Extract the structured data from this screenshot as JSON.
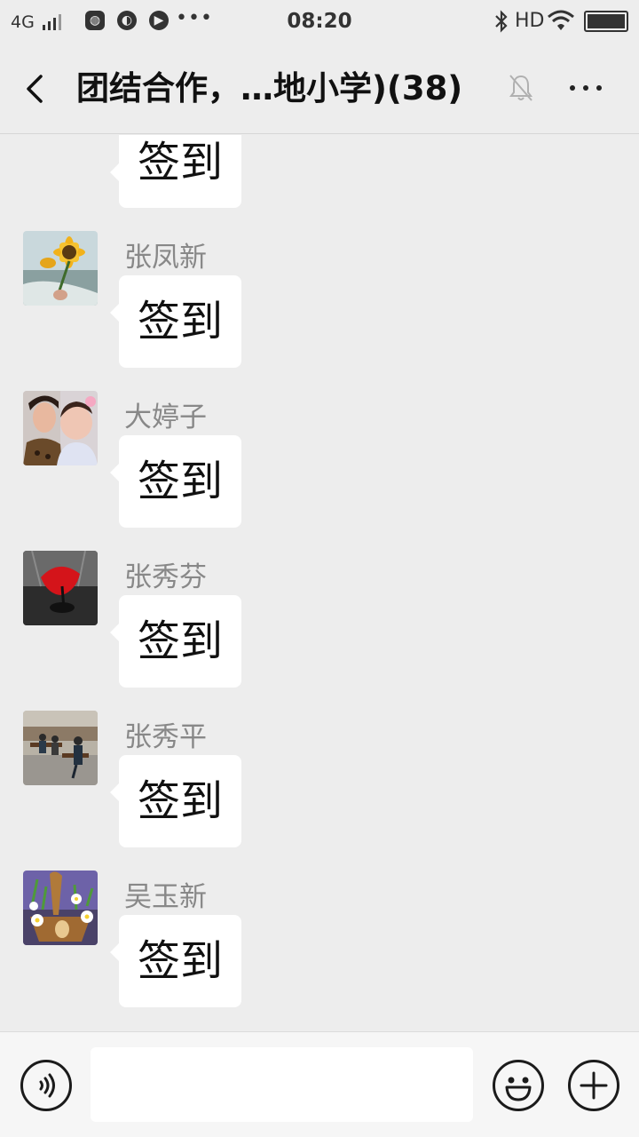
{
  "status_bar": {
    "network": "4G",
    "time": "08:20",
    "hd": "HD",
    "notification_icons": [
      "browser-icon",
      "chat-notification-icon",
      "music-player-icon"
    ],
    "overflow": "•••"
  },
  "header": {
    "title": "团结合作，…地小学)(38)",
    "muted": true
  },
  "messages": [
    {
      "sender": "",
      "text": "签到",
      "avatar_icon": "avatar-partial"
    },
    {
      "sender": "张凤新",
      "text": "签到",
      "avatar_icon": "sunflower-avatar"
    },
    {
      "sender": "大婷子",
      "text": "签到",
      "avatar_icon": "selfie-avatar"
    },
    {
      "sender": "张秀芬",
      "text": "签到",
      "avatar_icon": "red-umbrella-avatar"
    },
    {
      "sender": "张秀平",
      "text": "签到",
      "avatar_icon": "park-photo-avatar"
    },
    {
      "sender": "吴玉新",
      "text": "签到",
      "avatar_icon": "flower-basket-avatar"
    }
  ],
  "input_bar": {
    "voice_icon": "voice-icon",
    "text_value": "",
    "emoji_icon": "emoji-icon",
    "plus_icon": "plus-icon"
  },
  "colors": {
    "background": "#ededed",
    "bubble": "#ffffff",
    "sender_name": "#888888",
    "message_text": "#111111"
  }
}
